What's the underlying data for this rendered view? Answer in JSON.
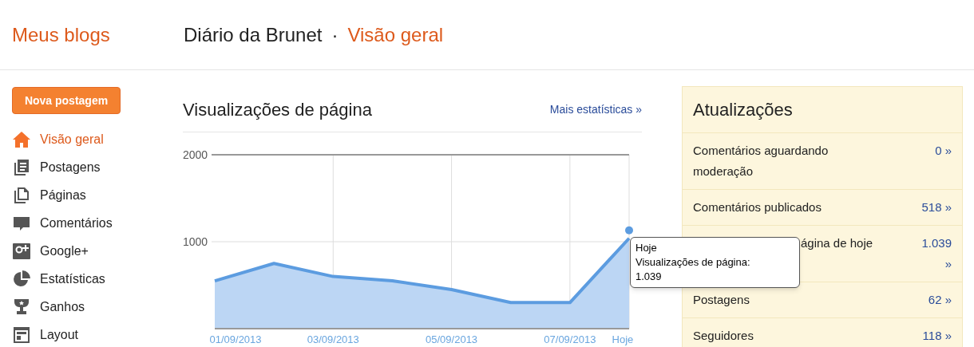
{
  "header": {
    "brand": "Meus blogs",
    "blog_title": "Diário da Brunet",
    "separator": "·",
    "page_title": "Visão geral"
  },
  "new_post_button": "Nova postagem",
  "nav": [
    {
      "label": "Visão geral",
      "kind": "home",
      "selected": true
    },
    {
      "label": "Postagens",
      "kind": "posts",
      "selected": false
    },
    {
      "label": "Páginas",
      "kind": "pages",
      "selected": false
    },
    {
      "label": "Comentários",
      "kind": "comments",
      "selected": false
    },
    {
      "label": "Google+",
      "kind": "gplus",
      "selected": false
    },
    {
      "label": "Estatísticas",
      "kind": "stats",
      "selected": false
    },
    {
      "label": "Ganhos",
      "kind": "trophy",
      "selected": false
    },
    {
      "label": "Layout",
      "kind": "layout",
      "selected": false
    }
  ],
  "pageviews": {
    "title": "Visualizações de página",
    "more_link": "Mais estatísticas »",
    "chart_data": {
      "type": "area",
      "categories": [
        "01/09/2013",
        null,
        "03/09/2013",
        null,
        "05/09/2013",
        null,
        "07/09/2013",
        "Hoje"
      ],
      "grid": true,
      "ylim": [
        0,
        2000
      ],
      "yticks": [
        1000,
        2000
      ],
      "series": [
        {
          "color": "#5c9ce0",
          "values": [
            550,
            750,
            600,
            550,
            450,
            300,
            300,
            1039
          ]
        }
      ]
    },
    "tooltip": {
      "title": "Hoje",
      "label": "Visualizações de página:",
      "value": "1.039"
    }
  },
  "updates": {
    "title": "Atualizações",
    "rows": [
      {
        "label": "Comentários aguardando moderação",
        "value": "0 »"
      },
      {
        "label": "Comentários publicados",
        "value": "518 »"
      },
      {
        "label": "ágina de hoje",
        "value": "1.039 »",
        "covered": true
      },
      {
        "label": "Postagens",
        "value": "62 »"
      },
      {
        "label": "Seguidores",
        "value": "118 »"
      }
    ]
  }
}
